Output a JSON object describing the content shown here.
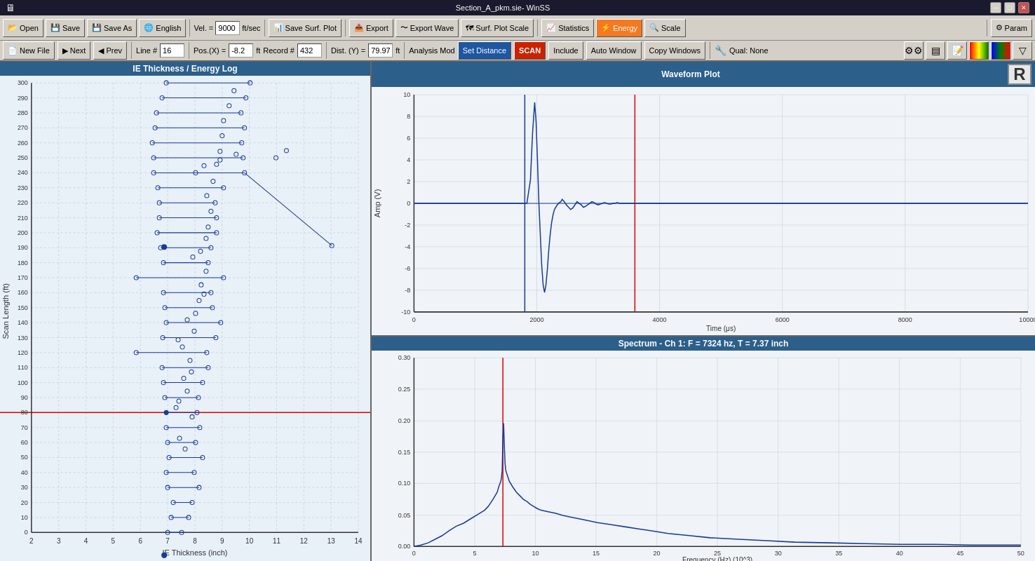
{
  "window": {
    "title": "Section_A_pkm.sie- WinSS",
    "controls": [
      "minimize",
      "maximize",
      "close"
    ]
  },
  "toolbar1": {
    "open_label": "Open",
    "save_label": "Save",
    "saveas_label": "Save As",
    "english_label": "English",
    "vel_label": "Vel. =",
    "vel_value": "9000",
    "vel_unit": "ft/sec",
    "savesurf_label": "Save Surf. Plot",
    "export_label": "Export",
    "exportwave_label": "Export Wave",
    "surfplotscale_label": "Surf. Plot Scale",
    "statistics_label": "Statistics",
    "energy_label": "Energy",
    "scale_label": "Scale",
    "param_label": "Param"
  },
  "toolbar2": {
    "newfile_label": "New File",
    "next_label": "Next",
    "prev_label": "Prev",
    "line_label": "Line #",
    "line_value": "16",
    "posx_label": "Pos.(X) =",
    "posx_value": "-8.2",
    "posx_unit": "ft",
    "record_label": "Record #",
    "record_value": "432",
    "disty_label": "Dist. (Y) =",
    "disty_value": "79.97",
    "disty_unit": "ft",
    "analysis_mod_label": "Analysis Mod",
    "set_distance_label": "Set Distance",
    "scan_label": "SCAN",
    "include_label": "Include",
    "auto_window_label": "Auto Window",
    "copy_windows_label": "Copy Windows",
    "qual_label": "Qual: None"
  },
  "left_chart": {
    "title": "IE Thickness / Energy Log",
    "x_axis_label": "IE Thickness (inch)",
    "y_axis_label": "Scan Length (ft)",
    "x_min": 2,
    "x_max": 14,
    "y_min": 0,
    "y_max": 300,
    "x_ticks": [
      2,
      3,
      4,
      5,
      6,
      7,
      8,
      9,
      10,
      11,
      12,
      13,
      14
    ],
    "y_ticks": [
      0,
      10,
      20,
      30,
      40,
      50,
      60,
      70,
      80,
      90,
      100,
      110,
      120,
      130,
      140,
      150,
      160,
      170,
      180,
      190,
      200,
      210,
      220,
      230,
      240,
      250,
      260,
      270,
      280,
      290,
      300
    ]
  },
  "waveform_chart": {
    "title": "Waveform Plot",
    "x_axis_label": "Time (μs)",
    "y_axis_label": "Amp (V)",
    "x_min": 0,
    "x_max": 10000,
    "y_min": -10,
    "y_max": 10,
    "x_ticks": [
      0,
      2000,
      4000,
      6000,
      8000,
      10000
    ],
    "y_ticks": [
      -10,
      -8,
      -6,
      -4,
      -2,
      0,
      2,
      4,
      6,
      8,
      10
    ]
  },
  "spectrum_chart": {
    "title": "Spectrum - Ch 1: F = 7324 hz, T = 7.37 inch",
    "x_axis_label": "Frequency (Hz) (10^3)",
    "y_axis_label": "",
    "x_min": 0,
    "x_max": 50,
    "y_min": 0.0,
    "y_max": 0.3,
    "x_ticks": [
      0,
      5,
      10,
      15,
      20,
      25,
      30,
      35,
      40,
      45,
      50
    ],
    "y_ticks": [
      0.0,
      0.05,
      0.1,
      0.15,
      0.2,
      0.25,
      0.3
    ]
  },
  "icons": {
    "open": "📂",
    "save": "💾",
    "saveas": "💾",
    "english": "🌐",
    "savesurf": "📊",
    "export": "📤",
    "exportwave": "〜",
    "surfplot": "🗺",
    "statistics": "📈",
    "energy": "⚡",
    "scale": "🔍",
    "param": "⚙",
    "newfile": "📄",
    "next": "▶",
    "prev": "◀",
    "toolbar_icons": [
      "⚙⚙⚙",
      "📋",
      "📝",
      "🌈",
      "🌈",
      "🔧"
    ]
  }
}
